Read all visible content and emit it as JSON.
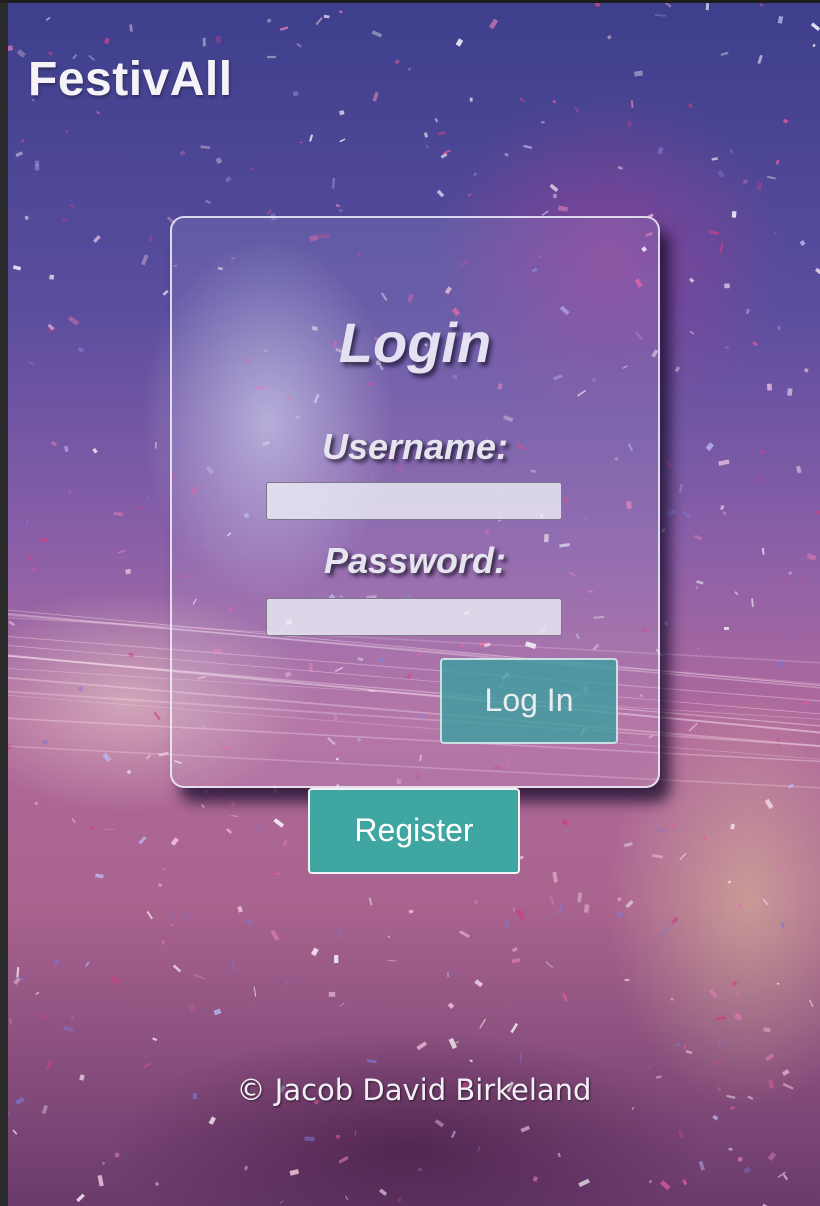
{
  "header": {
    "brand": "FestivAll"
  },
  "login": {
    "title": "Login",
    "username_label": "Username:",
    "username_value": "",
    "password_label": "Password:",
    "password_value": "",
    "submit_label": "Log In"
  },
  "register": {
    "label": "Register"
  },
  "footer": {
    "copyright": "© Jacob David Birkeland"
  },
  "colors": {
    "accent": "#40a6a2",
    "text": "#f5f3f8",
    "background_tone": "#8a5fa8"
  },
  "background": {
    "description_icon": "festival-crowd-confetti-photo"
  }
}
